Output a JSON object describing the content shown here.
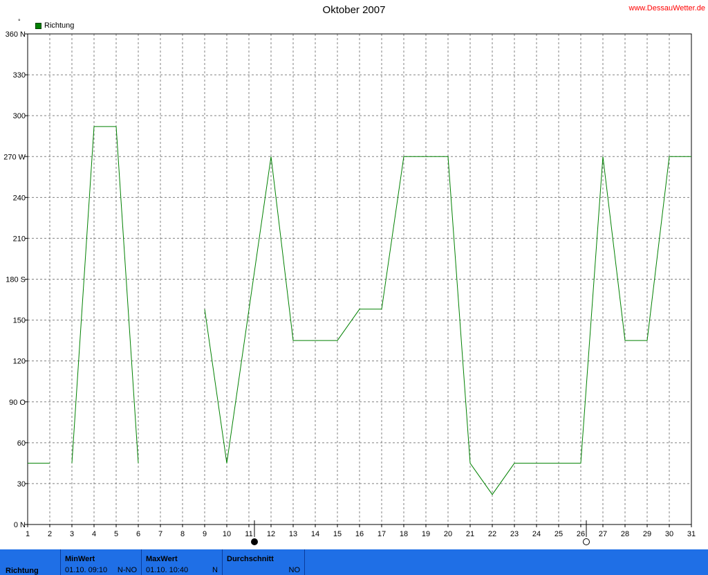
{
  "header": {
    "title": "Oktober 2007",
    "site": "www.DessauWetter.de",
    "unit_symbol": "°"
  },
  "legend": {
    "label": "Richtung",
    "color": "#008000"
  },
  "chart_data": {
    "type": "line",
    "title": "Oktober 2007",
    "xlabel": "",
    "ylabel": "",
    "xlim": [
      1,
      31
    ],
    "ylim": [
      0,
      360
    ],
    "x_ticks": [
      1,
      2,
      3,
      4,
      5,
      6,
      7,
      8,
      9,
      10,
      11,
      12,
      13,
      14,
      15,
      16,
      17,
      18,
      19,
      20,
      21,
      22,
      23,
      24,
      25,
      26,
      27,
      28,
      29,
      30,
      31
    ],
    "y_ticks": [
      {
        "value": 0,
        "label": "0  N"
      },
      {
        "value": 30,
        "label": "30"
      },
      {
        "value": 60,
        "label": "60"
      },
      {
        "value": 90,
        "label": "90  O"
      },
      {
        "value": 120,
        "label": "120"
      },
      {
        "value": 150,
        "label": "150"
      },
      {
        "value": 180,
        "label": "180 S"
      },
      {
        "value": 210,
        "label": "210"
      },
      {
        "value": 240,
        "label": "240"
      },
      {
        "value": 270,
        "label": "270 W"
      },
      {
        "value": 300,
        "label": "300"
      },
      {
        "value": 330,
        "label": "330"
      },
      {
        "value": 360,
        "label": "360 N"
      }
    ],
    "grid": true,
    "legend_position": "top-left",
    "series": [
      {
        "name": "Richtung",
        "color": "#008000",
        "segments": [
          [
            [
              1,
              45
            ],
            [
              2,
              45
            ]
          ],
          [
            [
              3,
              45
            ],
            [
              4,
              292
            ],
            [
              5,
              292
            ],
            [
              6,
              45
            ]
          ],
          [
            [
              9,
              158
            ],
            [
              10,
              45
            ],
            [
              12,
              270
            ],
            [
              13,
              135
            ],
            [
              15,
              135
            ],
            [
              16,
              158
            ],
            [
              17,
              158
            ],
            [
              18,
              270
            ],
            [
              20,
              270
            ],
            [
              21,
              45
            ],
            [
              22,
              22
            ],
            [
              23,
              45
            ],
            [
              26,
              45
            ],
            [
              27,
              270
            ],
            [
              28,
              135
            ],
            [
              29,
              135
            ],
            [
              30,
              270
            ],
            [
              31,
              270
            ]
          ]
        ]
      }
    ],
    "moon_phases": [
      {
        "x": 11.25,
        "phase": "new-moon"
      },
      {
        "x": 26.25,
        "phase": "full-moon"
      }
    ]
  },
  "stats": {
    "row_label": "Richtung",
    "min": {
      "header": "MinWert",
      "time": "01.10.  09:10",
      "value": "N-NO"
    },
    "max": {
      "header": "MaxWert",
      "time": "01.10.  10:40",
      "value": "N"
    },
    "avg": {
      "header": "Durchschnitt",
      "value": "NO"
    }
  }
}
